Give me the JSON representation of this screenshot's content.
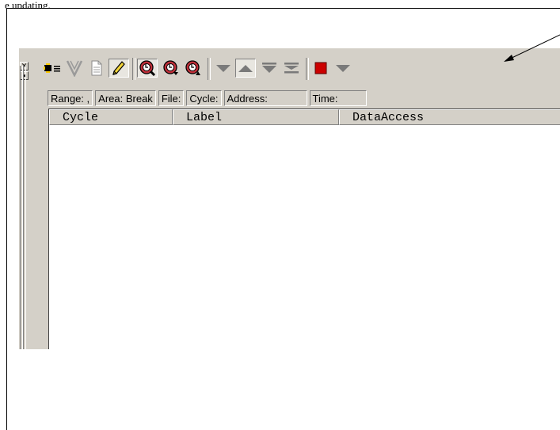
{
  "caption": "e updating.",
  "toolbar": {
    "buttons": [
      {
        "name": "trace-acquire-icon",
        "pressed": false
      },
      {
        "name": "filter-icon",
        "pressed": false
      },
      {
        "name": "document-icon",
        "pressed": false
      },
      {
        "name": "pencil-icon",
        "pressed": true
      },
      {
        "name": "find-icon",
        "pressed": true
      },
      {
        "name": "find-next-icon",
        "pressed": false
      },
      {
        "name": "find-prev-icon",
        "pressed": false
      },
      {
        "name": "scroll-down-icon",
        "pressed": false
      },
      {
        "name": "scroll-up-icon",
        "pressed": true
      },
      {
        "name": "scroll-bottom-icon",
        "pressed": false
      },
      {
        "name": "scroll-top-icon",
        "pressed": false
      },
      {
        "name": "stop-icon",
        "pressed": false
      },
      {
        "name": "dropdown-icon",
        "pressed": false
      }
    ],
    "colors": {
      "stop": "#cc0000",
      "arrow": "#7a7a7a",
      "find": "#c0303a"
    }
  },
  "status": {
    "range": "Range: ,",
    "area": "Area: Break",
    "file": "File:",
    "cycle": "Cycle:",
    "address": "Address:",
    "time": "Time:"
  },
  "columns": {
    "cycle": "Cycle",
    "label": "Label",
    "data_access": "DataAccess"
  }
}
